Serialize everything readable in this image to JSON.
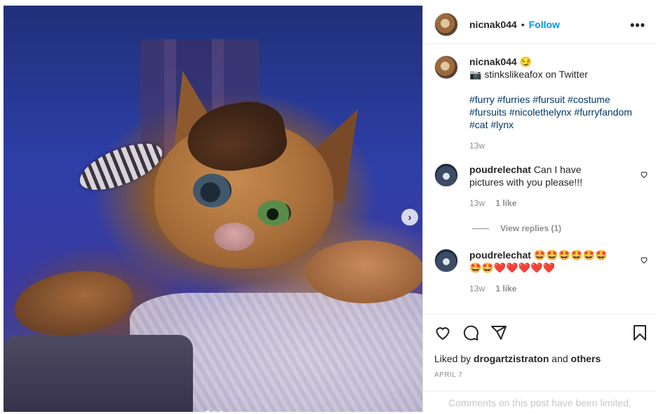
{
  "post": {
    "image_alt": "",
    "carousel_dots": 3,
    "carousel_active": 0
  },
  "header": {
    "username": "nicnak044",
    "separator": "•",
    "follow_label": "Follow",
    "more_label": "•••"
  },
  "caption": {
    "username": "nicnak044",
    "emoji": "😏",
    "line1": "📷 stinkslikeafox on Twitter",
    "hashtags": "#furry #furries #fursuit #costume #fursuits #nicolethelynx #furryfandom #cat #lynx",
    "time": "13w"
  },
  "comments": [
    {
      "username": "poudrelechat",
      "text": "Can I have pictures with you please!!!",
      "time": "13w",
      "likes": "1 like",
      "view_replies": "View replies (1)"
    },
    {
      "username": "poudrelechat",
      "text": "🤩🤩🤩🤩🤩🤩🤩🤩❤️❤️❤️❤️❤️",
      "time": "13w",
      "likes": "1 like"
    }
  ],
  "likes": {
    "prefix": "Liked by",
    "user": "drogartzistraton",
    "and": "and",
    "others": "others"
  },
  "date": "APRIL 7",
  "limited_text": "Comments on this post have been limited."
}
